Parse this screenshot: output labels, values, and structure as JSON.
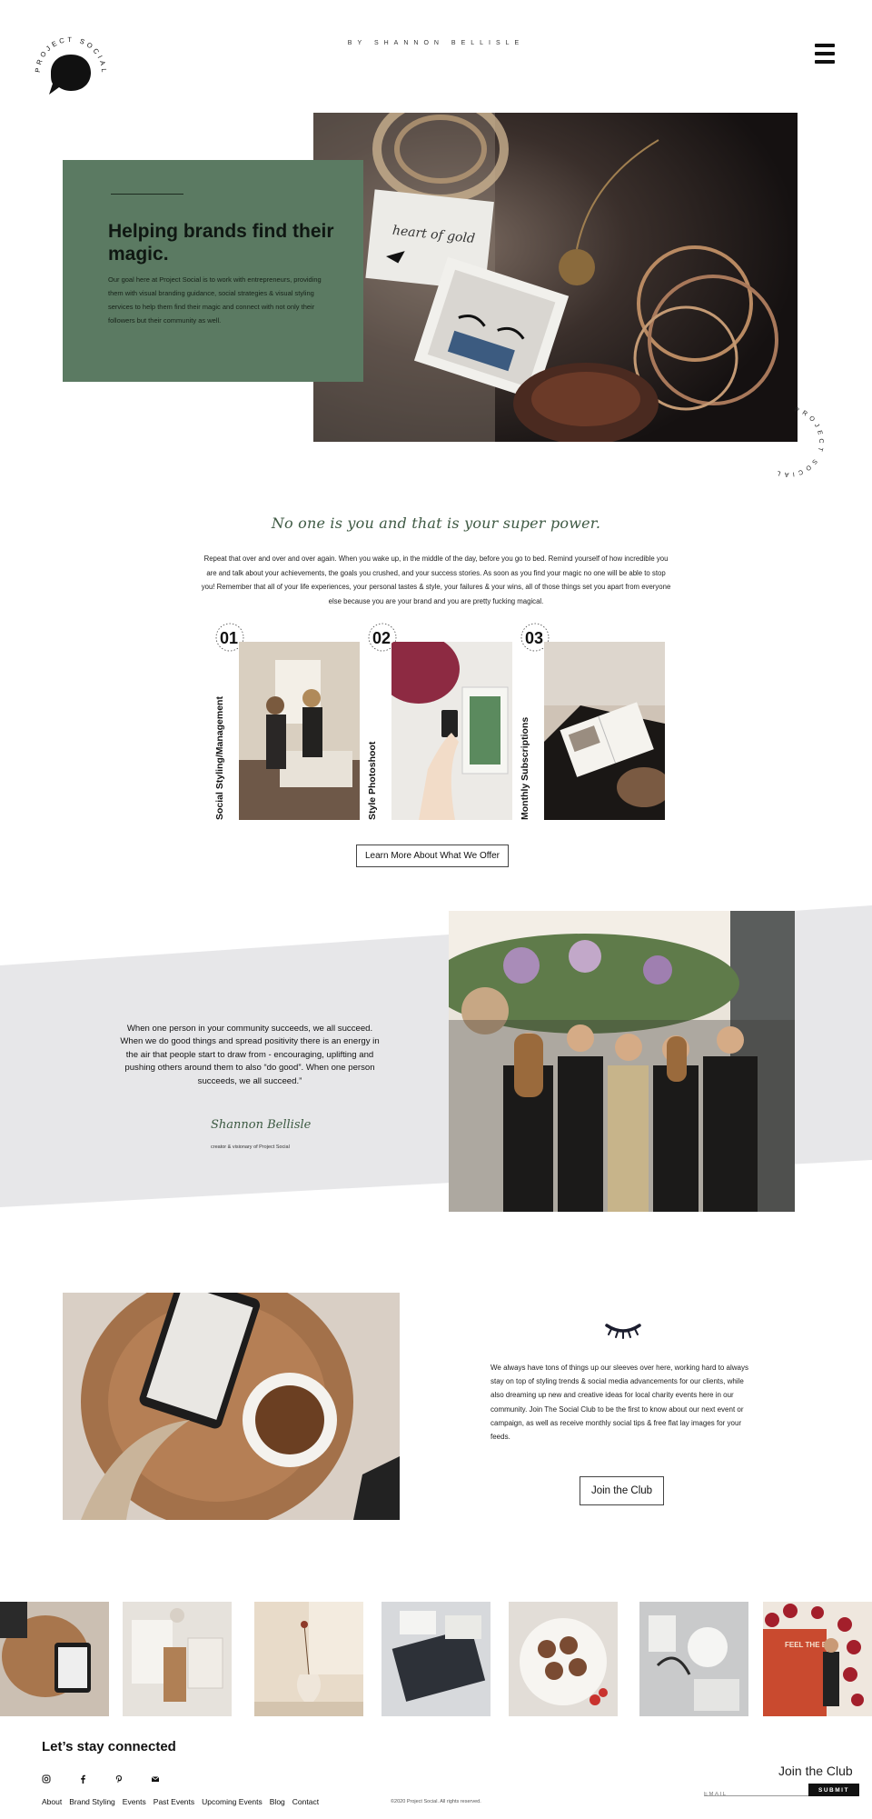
{
  "header": {
    "tagline": "BY SHANNON BELLISLE",
    "logo_text": "PROJECT SOCIAL",
    "menu_icon": "hamburger-icon"
  },
  "hero": {
    "title": "Helping brands find their magic.",
    "body": "Our goal here at Project Social is to work with entrepreneurs, providing them with visual branding guidance, social strategies & visual styling services to help them find their magic and connect with not only their followers but their community as well.",
    "card_color": "#5b7a62",
    "corner_text": "PROJECT SOCIAL"
  },
  "statement": {
    "title": "No one is you and that is your super power.",
    "body": "Repeat that over and over and over again. When you wake up, in the middle of the day, before you go to bed. Remind yourself of how incredible you are and talk about your achievements, the goals you crushed, and your success stories. As soon as you find your magic no one will be able to stop you! Remember that all of your life experiences, your personal tastes & style, your failures & your wins, all of those things set you apart from everyone else because you are your brand and you are pretty fucking magical."
  },
  "services": [
    {
      "number": "01",
      "label": "Social Styling/Management"
    },
    {
      "number": "02",
      "label": "Style Photoshoot"
    },
    {
      "number": "03",
      "label": "Monthly Subscriptions"
    }
  ],
  "services_button": "Learn More About What We Offer",
  "quote": {
    "text": "When one person in your community succeeds, we all succeed. When we do good things and spread positivity there is an energy in the air that people start to draw from - encouraging, uplifting and pushing others around them to also “do good”. When one person succeeds, we all succeed.”",
    "signature": "Shannon Bellisle",
    "caption": "creator & visionary of Project Social"
  },
  "club": {
    "icon": "eyelash-icon",
    "body": "We always have tons of things up our sleeves over here, working hard to always stay on top of styling trends & social media advancements for our clients, while also dreaming up new and creative ideas for local charity events here in our community. Join The Social Club to be the first to know about our next event or campaign, as well as receive monthly social tips & free flat lay images for your feeds.",
    "button": "Join the Club"
  },
  "instagram_overlay_text": "FEEL THE BEAT",
  "footer": {
    "heading": "Let’s stay connected",
    "social_icons": [
      "instagram-icon",
      "facebook-icon",
      "pinterest-icon",
      "email-icon"
    ],
    "nav": [
      "About",
      "Brand Styling",
      "Events",
      "Past Events",
      "Upcoming Events",
      "Blog",
      "Contact"
    ],
    "copyright": "©2020 Project Social. All rights reserved.",
    "join_title": "Join the Club",
    "email_placeholder": "EMAIL",
    "submit_label": "SUBMIT"
  }
}
